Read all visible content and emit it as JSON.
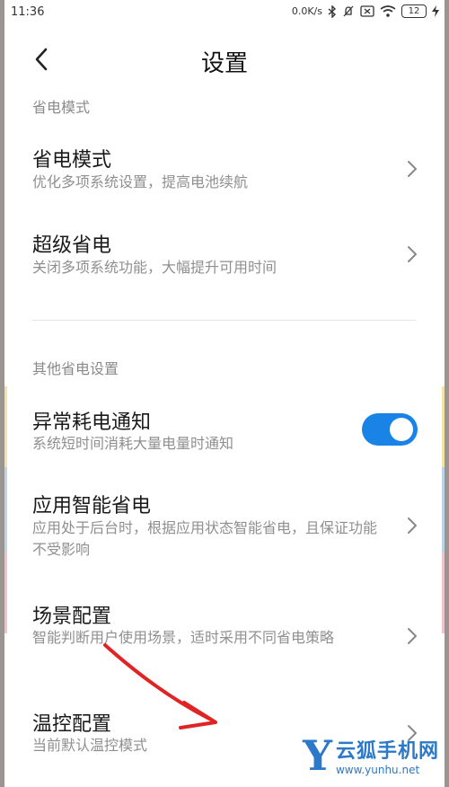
{
  "status_bar": {
    "time": "11:36",
    "net_speed": "0.0K/s",
    "battery": "12",
    "icons": [
      "bluetooth-icon",
      "mute-icon",
      "close-box-icon",
      "wifi-icon",
      "battery-icon",
      "charging-icon"
    ]
  },
  "header": {
    "title": "设置",
    "back_icon": "chevron-left-icon"
  },
  "sections": {
    "power_mode": {
      "label": "省电模式",
      "items": [
        {
          "title": "省电模式",
          "desc": "优化多项系统设置，提高电池续航"
        },
        {
          "title": "超级省电",
          "desc": "关闭多项系统功能，大幅提升可用时间"
        }
      ]
    },
    "other": {
      "label": "其他省电设置",
      "items": [
        {
          "title": "异常耗电通知",
          "desc": "系统短时间消耗大量电量时通知",
          "toggle_on": true
        },
        {
          "title": "应用智能省电",
          "desc": "应用处于后台时，根据应用状态智能省电，且保证功能不受影响"
        },
        {
          "title": "场景配置",
          "desc": "智能判断用户使用场景，适时采用不同省电策略"
        },
        {
          "title": "温控配置",
          "desc": "当前默认温控模式"
        }
      ]
    }
  },
  "colors": {
    "accent": "#1a84e6",
    "annotation_arrow": "#e02424",
    "watermark": "#2c78c9"
  },
  "watermark": {
    "logo_letter": "Y",
    "name": "云狐手机网",
    "url": "www.yunhu.net"
  }
}
